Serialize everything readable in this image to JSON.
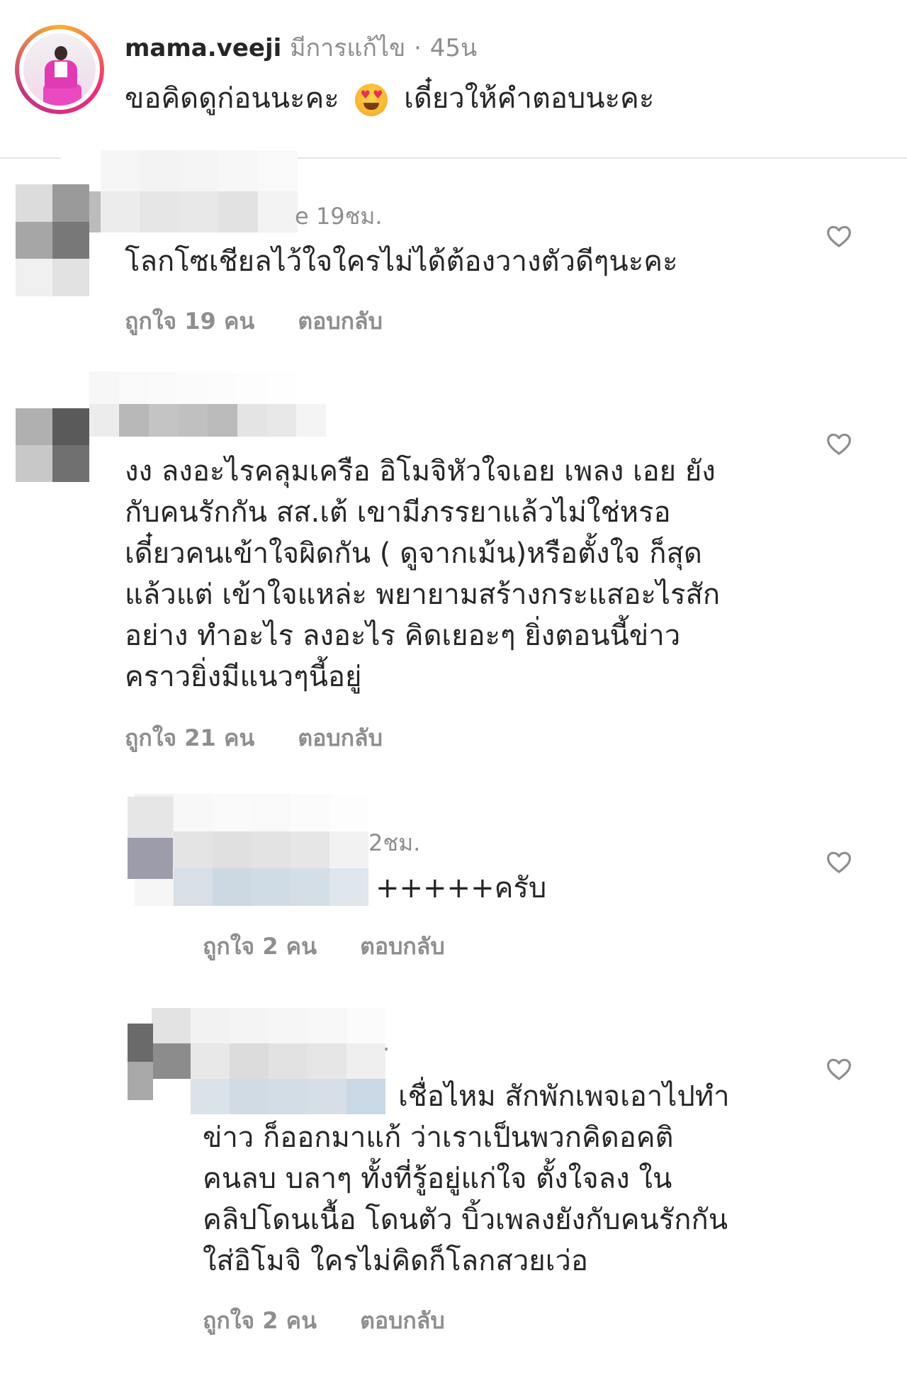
{
  "post": {
    "username": "mama.veeji",
    "edited_label": "มีการแก้ไข",
    "separator": "·",
    "time": "45น",
    "text_before_emoji": "ขอคิดดูก่อนนะคะ",
    "emoji": "heart-eyes-emoji",
    "text_after_emoji": "เดี๋ยวให้คำตอบนะคะ"
  },
  "comments": [
    {
      "time": "e 19ชม.",
      "text": "โลกโซเชียลไว้ใจใครไม่ได้ต้องวางตัวดีๆนะคะ",
      "likes": "ถูกใจ 19 คน",
      "reply": "ตอบกลับ"
    },
    {
      "text": "งง ลงอะไรคลุมเครือ อิโมจิหัวใจเอย เพลง เอย ยังกับคนรักกัน สส.เต้ เขามีภรรยาแล้วไม่ใช่หรอ เดี๋ยวคนเข้าใจผิดกัน ( ดูจากเม้น)หรือตั้งใจ ก็สุดแล้วแต่ เข้าใจแหล่ะ พยายามสร้างกระแสอะไรสักอย่าง ทำอะไร ลงอะไร คิดเยอะๆ ยิ่งตอนนี้ข่าวคราวยิ่งมีแนวๆนี้อยู่",
      "lines": [
        "งง ลงอะไรคลุมเครือ อิโมจิหัวใจเอย เพลง เอย ยัง",
        "กับคนรักกัน สส.เต้ เขามีภรรยาแล้วไม่ใช่หรอ",
        "เดี๋ยวคนเข้าใจผิดกัน ( ดูจากเม้น)หรือตั้งใจ ก็สุด",
        "แล้วแต่ เข้าใจแหล่ะ พยายามสร้างกระแสอะไรสัก",
        "อย่าง ทำอะไร ลงอะไร คิดเยอะๆ ยิ่งตอนนี้ข่าว",
        "คราวยิ่งมีแนวๆนี้อยู่"
      ],
      "likes": "ถูกใจ 21 คน",
      "reply": "ตอบกลับ"
    },
    {
      "time": "2ชม.",
      "text": "+++++ครับ",
      "likes": "ถูกใจ 2 คน",
      "reply": "ตอบกลับ"
    },
    {
      "time": ".",
      "lines": [
        "เชื่อไหม สักพักเพจเอาไปทำ",
        "ข่าว ก็ออกมาแก้ ว่าเราเป็นพวกคิดอคติ",
        "คนลบ บลาๆ ทั้งที่รู้อยู่แก่ใจ ตั้งใจลง ใน",
        "คลิปโดนเนื้อ โดนตัว บิ้วเพลงยังกับคนรักกัน",
        "ใส่อิโมจิ ใครไม่คิดก็โลกสวยเว่อ"
      ],
      "likes": "ถูกใจ 2 คน",
      "reply": "ตอบกลับ"
    }
  ],
  "icons": {
    "like": "heart-outline-icon"
  },
  "colors": {
    "text": "#262626",
    "meta": "#8e8e8e",
    "divider": "#e6e6e6",
    "story_ring": [
      "#f9b232",
      "#ee2a7b",
      "#c13584"
    ]
  }
}
